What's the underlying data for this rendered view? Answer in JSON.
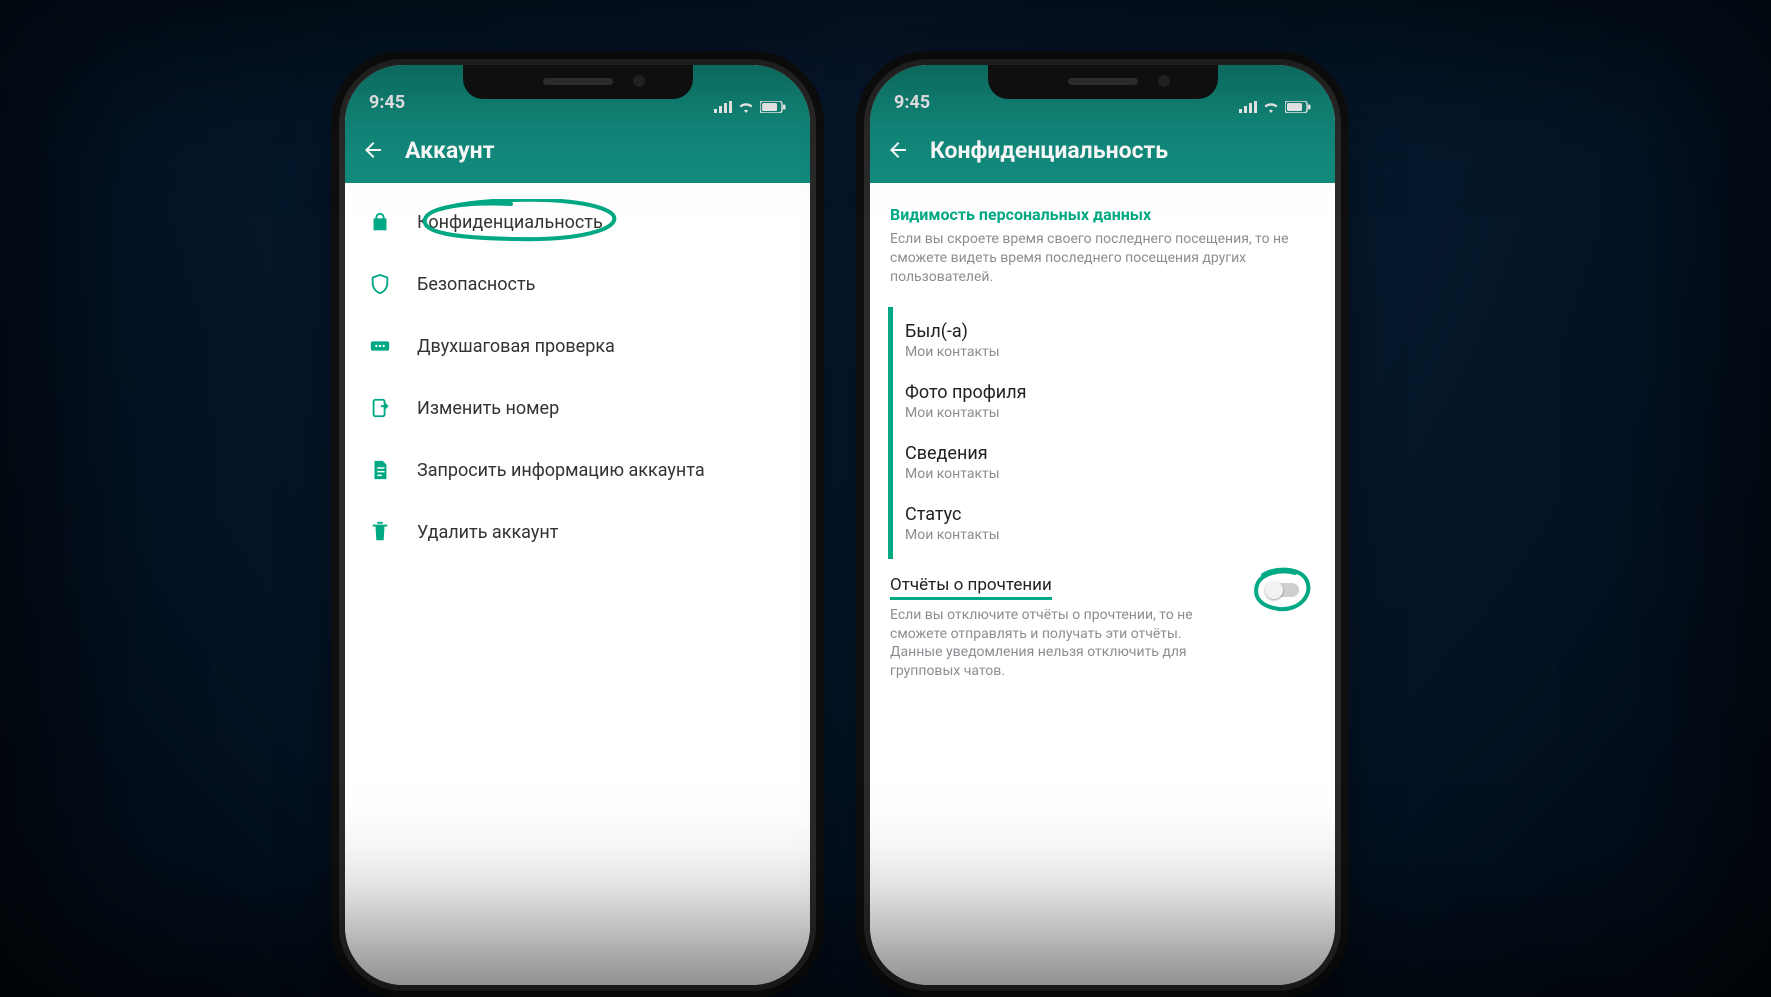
{
  "status": {
    "time": "9:45"
  },
  "left": {
    "title": "Аккаунт",
    "items": [
      {
        "label": "Конфиденциальность"
      },
      {
        "label": "Безопасность"
      },
      {
        "label": "Двухшаговая проверка"
      },
      {
        "label": "Изменить номер"
      },
      {
        "label": "Запросить информацию аккаунта"
      },
      {
        "label": "Удалить аккаунт"
      }
    ]
  },
  "right": {
    "title": "Конфиденциальность",
    "section_title": "Видимость персональных данных",
    "section_desc": "Если вы скроете время своего последнего посещения, то не сможете видеть время последнего посещения других пользователей.",
    "rows": [
      {
        "title": "Был(-а)",
        "sub": "Мои контакты"
      },
      {
        "title": "Фото профиля",
        "sub": "Мои контакты"
      },
      {
        "title": "Сведения",
        "sub": "Мои контакты"
      },
      {
        "title": "Статус",
        "sub": "Мои контакты"
      }
    ],
    "read_receipts": {
      "title": "Отчёты о прочтении",
      "desc": "Если вы отключите отчёты о прочтении, то не сможете отправлять и получать эти отчёты. Данные уведомления нельзя отключить для групповых чатов.",
      "enabled": false
    }
  }
}
